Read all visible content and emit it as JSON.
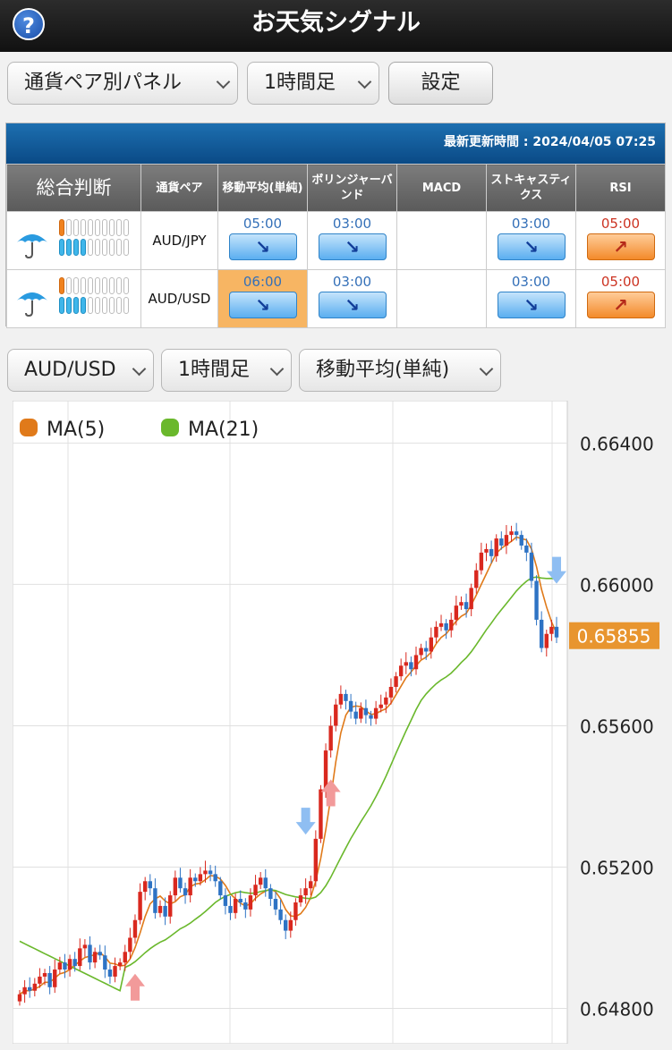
{
  "header": {
    "title": "お天気シグナル",
    "help": "?"
  },
  "controls": {
    "panel_select": "通貨ペア別パネル",
    "timeframe_select": "1時間足",
    "settings_button": "設定"
  },
  "panel": {
    "updated": "最新更新時間 : 2024/04/05 07:25",
    "columns": [
      "総合判断",
      "通貨ペア",
      "移動平均(単純)",
      "ボリンジャーバンド",
      "MACD",
      "ストキャスティクス",
      "RSI"
    ],
    "rows": [
      {
        "weather_icon": "umbrella-icon",
        "up_level": 1,
        "down_level": 4,
        "pair": "AUD/JPY",
        "ma": {
          "time": "05:00",
          "dir": "down",
          "arrow": "↘"
        },
        "bb": {
          "time": "03:00",
          "dir": "down",
          "arrow": "↘"
        },
        "macd": null,
        "stoch": {
          "time": "03:00",
          "dir": "down",
          "arrow": "↘"
        },
        "rsi": {
          "time": "05:00",
          "dir": "up",
          "arrow": "↗"
        }
      },
      {
        "weather_icon": "umbrella-icon",
        "up_level": 1,
        "down_level": 4,
        "pair": "AUD/USD",
        "ma": {
          "time": "06:00",
          "dir": "down",
          "arrow": "↘",
          "highlight": true
        },
        "bb": {
          "time": "03:00",
          "dir": "down",
          "arrow": "↘"
        },
        "macd": null,
        "stoch": {
          "time": "03:00",
          "dir": "down",
          "arrow": "↘"
        },
        "rsi": {
          "time": "05:00",
          "dir": "up",
          "arrow": "↗"
        }
      }
    ]
  },
  "chart_controls": {
    "pair_select": "AUD/USD",
    "timeframe_select": "1時間足",
    "indicator_select": "移動平均(単純)"
  },
  "colors": {
    "up_candle": "#d9281e",
    "down_candle": "#2e73c4",
    "ma5": "#e07a1a",
    "ma21": "#6ab82c",
    "price_tag": "#e8952f",
    "buy_arrow": "#f29a9a",
    "sell_arrow": "#8fbef2"
  },
  "chart_data": {
    "type": "candlestick",
    "legend": [
      "MA(5)",
      "MA(21)"
    ],
    "ylim": [
      0.647,
      0.6652
    ],
    "yticks": [
      "0.64800",
      "0.65200",
      "0.65600",
      "0.66000",
      "0.66400"
    ],
    "current_price": "0.65855",
    "closes": [
      0.6484,
      0.6486,
      0.6485,
      0.6487,
      0.6489,
      0.649,
      0.6486,
      0.6491,
      0.6493,
      0.6491,
      0.6494,
      0.6492,
      0.6497,
      0.6498,
      0.6493,
      0.6496,
      0.6495,
      0.6491,
      0.6489,
      0.6492,
      0.6493,
      0.6496,
      0.65,
      0.6505,
      0.6513,
      0.6516,
      0.6514,
      0.6507,
      0.6509,
      0.6506,
      0.6512,
      0.6517,
      0.6514,
      0.6512,
      0.6517,
      0.6516,
      0.6518,
      0.6519,
      0.6518,
      0.6516,
      0.6512,
      0.6509,
      0.6507,
      0.6511,
      0.651,
      0.6508,
      0.6512,
      0.6515,
      0.6517,
      0.6514,
      0.6511,
      0.6508,
      0.6505,
      0.6502,
      0.6505,
      0.651,
      0.6512,
      0.6514,
      0.6516,
      0.6528,
      0.6542,
      0.6553,
      0.656,
      0.6566,
      0.6569,
      0.6567,
      0.6564,
      0.6562,
      0.6565,
      0.6563,
      0.6562,
      0.6565,
      0.6566,
      0.6568,
      0.6571,
      0.6574,
      0.6577,
      0.6578,
      0.6576,
      0.658,
      0.6582,
      0.6581,
      0.6585,
      0.6588,
      0.6589,
      0.6587,
      0.659,
      0.6594,
      0.6595,
      0.6593,
      0.6599,
      0.6604,
      0.6609,
      0.661,
      0.6608,
      0.6613,
      0.6611,
      0.6614,
      0.6615,
      0.6614,
      0.6611,
      0.6609,
      0.6601,
      0.659,
      0.6582,
      0.6586,
      0.6588,
      0.6585
    ],
    "ma5_note": "",
    "signals": [
      {
        "type": "buy",
        "index": 23
      },
      {
        "type": "sell",
        "index": 57
      },
      {
        "type": "buy",
        "index": 62
      },
      {
        "type": "sell",
        "index": 107
      }
    ]
  }
}
